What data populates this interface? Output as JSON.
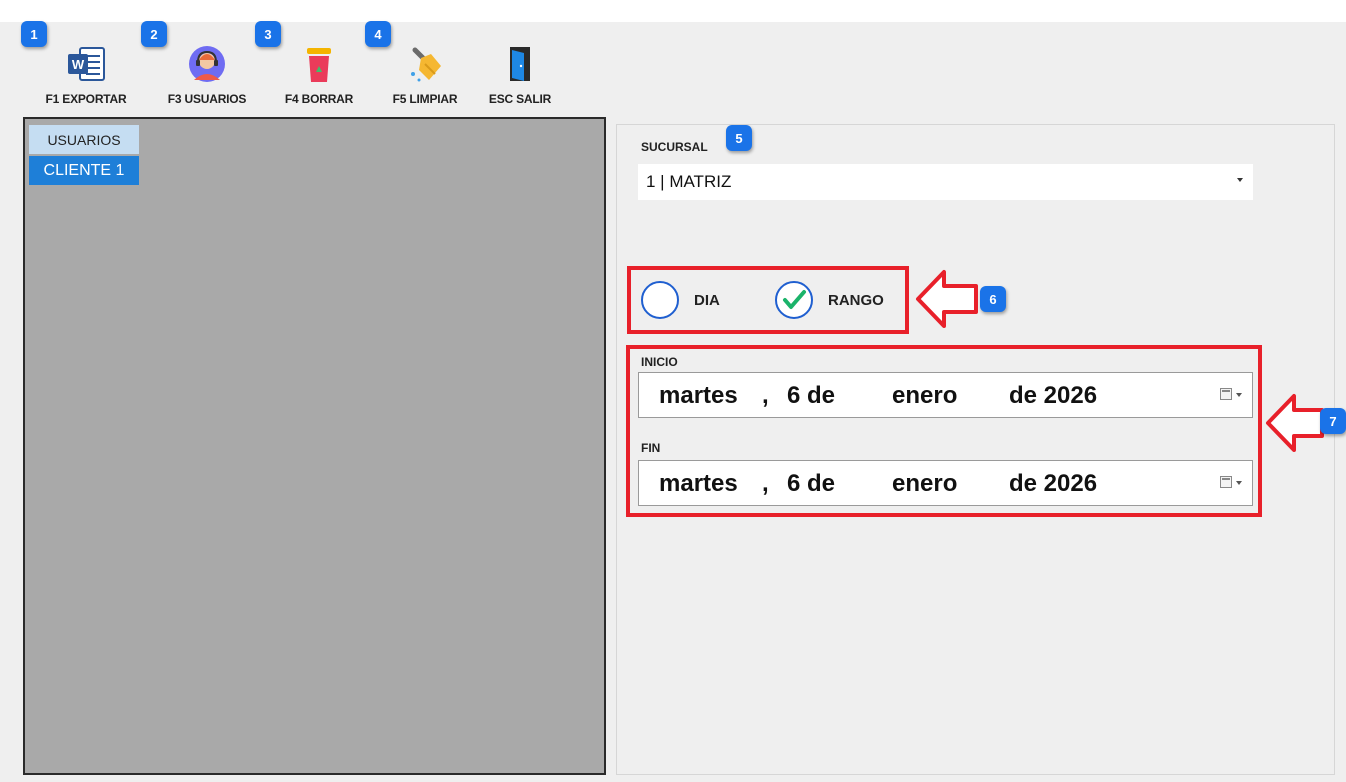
{
  "toolbar": {
    "export_label": "F1 EXPORTAR",
    "users_label": "F3 USUARIOS",
    "delete_label": "F4 BORRAR",
    "clear_label": "F5 LIMPIAR",
    "exit_label": "ESC SALIR"
  },
  "badges": [
    "1",
    "2",
    "3",
    "4",
    "5",
    "6",
    "7"
  ],
  "grid": {
    "header": "USUARIOS",
    "rows": [
      "CLIENTE 1"
    ]
  },
  "branch": {
    "label": "SUCURSAL",
    "value": "1 | MATRIZ"
  },
  "mode": {
    "day_label": "DIA",
    "range_label": "RANGO",
    "selected": "RANGO"
  },
  "start": {
    "label": "INICIO",
    "weekday": "martes",
    "sep": ",",
    "day": "6 de",
    "month": "enero",
    "year": "de 2026"
  },
  "end": {
    "label": "FIN",
    "weekday": "martes",
    "sep": ",",
    "day": "6 de",
    "month": "enero",
    "year": "de 2026"
  },
  "colors": {
    "accent": "#1a73e8",
    "highlight_red": "#e8202a",
    "selected_row": "#1e7fd8",
    "check_green": "#1bb36a"
  }
}
